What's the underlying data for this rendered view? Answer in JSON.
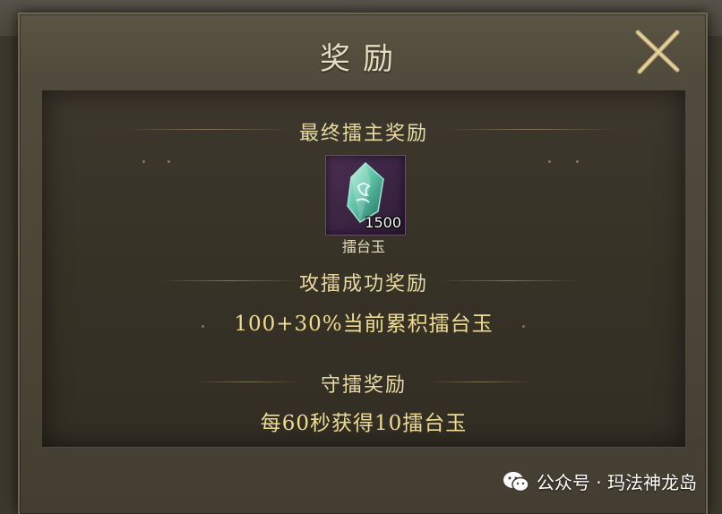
{
  "dialog": {
    "title": "奖励",
    "close_icon": "close-x-icon"
  },
  "final_champion": {
    "header": "最终擂主奖励",
    "item": {
      "name": "擂台玉",
      "count": "1500",
      "icon": "jade-crystal-icon"
    }
  },
  "attack_success": {
    "header": "攻擂成功奖励",
    "text": "100+30%当前累积擂台玉"
  },
  "defend": {
    "header": "守擂奖励",
    "text": "每60秒获得10擂台玉"
  },
  "watermark": {
    "icon": "wechat-icon",
    "text": "公众号 · 玛法神龙岛"
  },
  "colors": {
    "title_text": "#e7dcc0",
    "header_text": "#e9d9a3",
    "reward_text": "#f0dc90",
    "panel_bg": "#363226",
    "item_frame": "#3a2442",
    "crystal": "#5fc4a8"
  }
}
